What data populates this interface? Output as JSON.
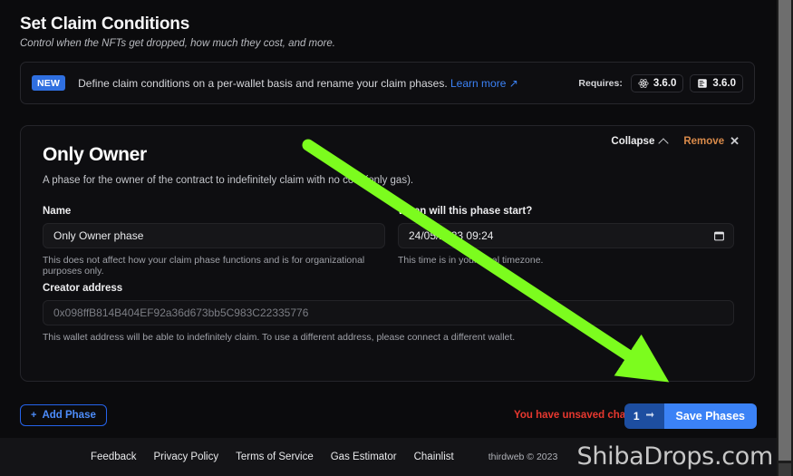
{
  "header": {
    "title": "Set Claim Conditions",
    "subtitle": "Control when the NFTs get dropped, how much they cost, and more."
  },
  "notice": {
    "badge": "NEW",
    "text": "Define claim conditions on a per-wallet basis and rename your claim phases.",
    "learn_more": "Learn more ↗",
    "requires_label": "Requires:",
    "versions": [
      {
        "icon": "react-atom-icon",
        "value": "3.6.0"
      },
      {
        "icon": "contract-icon",
        "value": "3.6.0"
      }
    ]
  },
  "phase": {
    "title": "Only Owner",
    "description": "A phase for the owner of the contract to indefinitely claim with no cost (only gas).",
    "collapse_label": "Collapse",
    "remove_label": "Remove",
    "fields": {
      "name": {
        "label": "Name",
        "value": "Only Owner phase",
        "helper": "This does not affect how your claim phase functions and is for organizational purposes only."
      },
      "start": {
        "label": "When will this phase start?",
        "value": "24/05/2023 09:24",
        "helper": "This time is in your local timezone."
      },
      "creator": {
        "label": "Creator address",
        "value": "0x098ffB814B404EF92a36d673bb5C983C22335776",
        "helper": "This wallet address will be able to indefinitely claim. To use a different address, please connect a different wallet."
      }
    }
  },
  "actions": {
    "add_phase": "Add Phase",
    "unsaved": "You have unsaved changes",
    "tx_count": "1",
    "save": "Save Phases"
  },
  "footer": {
    "links": [
      "Feedback",
      "Privacy Policy",
      "Terms of Service",
      "Gas Estimator",
      "Chainlist"
    ],
    "copyright": "thirdweb © 2023"
  },
  "watermark": "ShibaDrops.com",
  "colors": {
    "accent_blue": "#3b82f6",
    "badge_blue": "#2f6fe0",
    "unsaved_red": "#e8382f",
    "remove_orange": "#d98a4a",
    "arrow_green": "#7cfc1e",
    "page_bg": "#0b0b0d",
    "card_bg": "#0e0e11"
  }
}
